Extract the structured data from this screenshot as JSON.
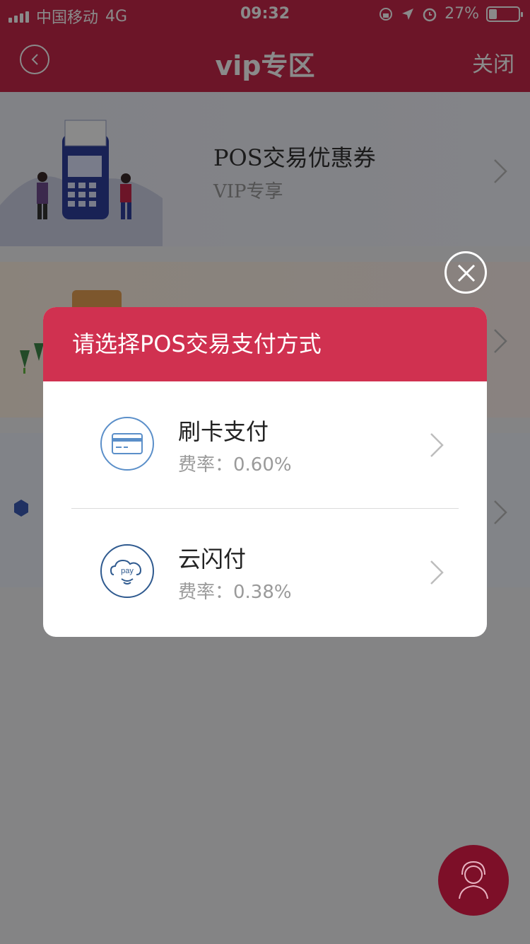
{
  "status_bar": {
    "carrier": "中国移动",
    "network": "4G",
    "time": "09:32",
    "battery": "27%",
    "battery_level": 0.27
  },
  "nav": {
    "title": "vip专区",
    "close_label": "关闭"
  },
  "background_list": {
    "card1_title": "POS交易优惠券",
    "card1_subtitle": "VIP专享"
  },
  "modal": {
    "title": "请选择POS交易支付方式",
    "options": [
      {
        "name": "刷卡支付",
        "rate": "费率：0.60%",
        "icon": "card-icon"
      },
      {
        "name": "云闪付",
        "rate": "费率：0.38%",
        "icon": "cloud-pay-icon",
        "icon_text": "pay"
      }
    ]
  },
  "colors": {
    "brand_red": "#c8284a",
    "modal_header": "#d03150",
    "icon_blue": "#5b8fc9",
    "fab": "#7d0f28"
  }
}
